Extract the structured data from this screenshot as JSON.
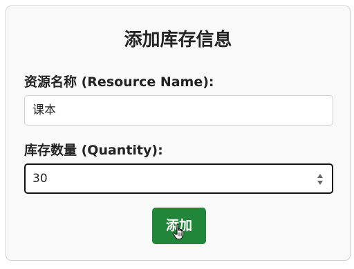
{
  "form": {
    "title": "添加库存信息",
    "resource_name_label": "资源名称 (Resource Name):",
    "resource_name_value": "课本",
    "quantity_label": "库存数量 (Quantity):",
    "quantity_value": "30",
    "submit_label": "添加"
  },
  "icons": {
    "spinner": "number-spinner-icon",
    "cursor": "hand-pointer-cursor-icon"
  },
  "colors": {
    "button": "#22863a",
    "card_background": "#f9f9f9",
    "focused_border": "#111111"
  }
}
